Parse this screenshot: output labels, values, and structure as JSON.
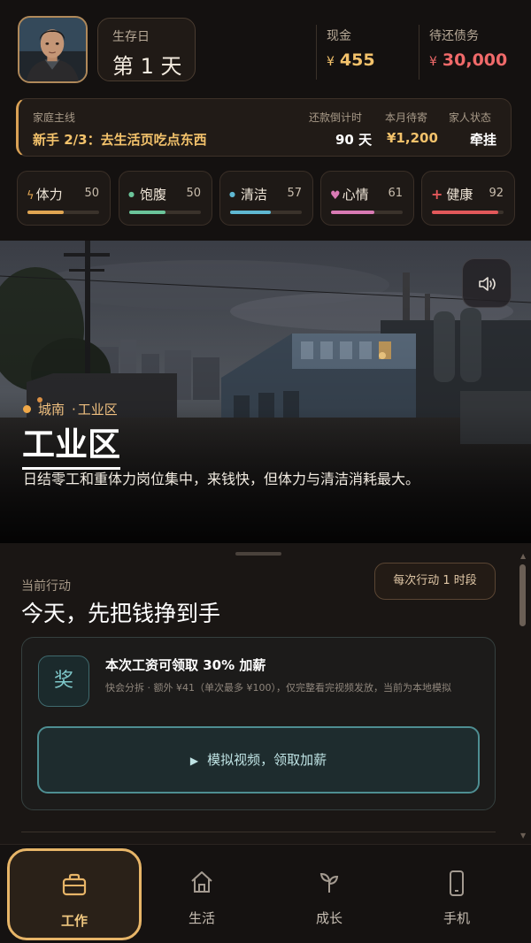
{
  "header": {
    "day_label": "生存日",
    "day_value": "第 1 天",
    "cash_label": "现金",
    "cash_currency": "¥",
    "cash_value": "455",
    "debt_label": "待还债务",
    "debt_currency": "¥",
    "debt_value": "30,000"
  },
  "mainline": {
    "label": "家庭主线",
    "task": "新手 2/3：去生活页吃点东西",
    "countdown_label": "还款倒计时",
    "countdown_value": "90 天",
    "monthly_label": "本月待寄",
    "monthly_value": "¥1,200",
    "family_label": "家人状态",
    "family_value": "牵挂"
  },
  "vitals": [
    {
      "icon": "ϟ",
      "label": "体力",
      "value": "50",
      "level": 0.5,
      "color": "#e0a552"
    },
    {
      "icon": "●",
      "label": "饱腹",
      "value": "50",
      "level": 0.5,
      "color": "#6bc49a"
    },
    {
      "icon": "●",
      "label": "清洁",
      "value": "57",
      "level": 0.57,
      "color": "#5fb8d2"
    },
    {
      "icon": "♥",
      "label": "心情",
      "value": "61",
      "level": 0.61,
      "color": "#d97ab4"
    },
    {
      "icon": "+",
      "label": "健康",
      "value": "92",
      "level": 0.92,
      "color": "#e2585a"
    }
  ],
  "scene": {
    "district": "城南",
    "zone": "工业区",
    "title": "工业区",
    "description": "日结零工和重体力岗位集中，来钱快，但体力与清洁消耗最大。"
  },
  "action": {
    "label": "当前行动",
    "title": "今天，先把钱挣到手",
    "per_action": "每次行动 1 时段",
    "reward_icon": "奖",
    "reward_title": "本次工资可领取 30% 加薪",
    "reward_desc": "快会分拆 · 额外 ¥41（单次最多 ¥100），仅完整看完视频发放，当前为本地模拟",
    "video_button": "模拟视频，领取加薪"
  },
  "nav": [
    {
      "label": "工作",
      "icon": "briefcase-icon",
      "active": true
    },
    {
      "label": "生活",
      "icon": "home-icon",
      "active": false
    },
    {
      "label": "成长",
      "icon": "sprout-icon",
      "active": false
    },
    {
      "label": "手机",
      "icon": "phone-icon",
      "active": false
    }
  ],
  "colors": {
    "accent": "#e7b568",
    "cash": "#f3c26b",
    "debt": "#f06a6a",
    "teal": "#4e8e92"
  }
}
